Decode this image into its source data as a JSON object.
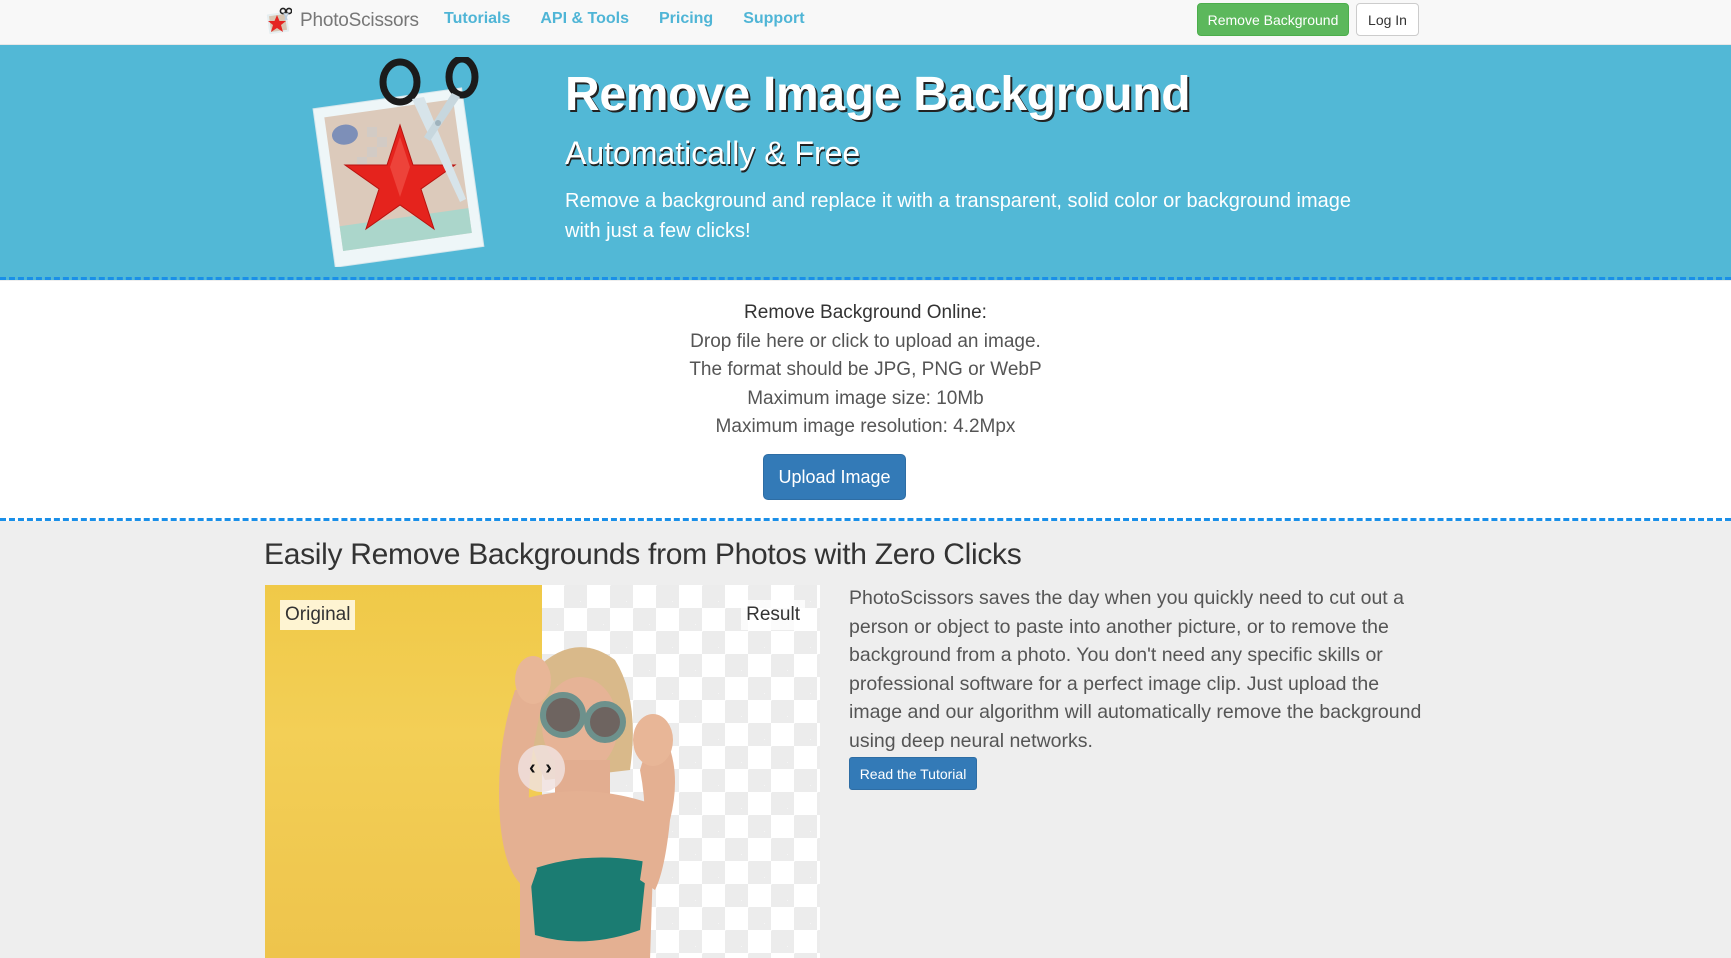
{
  "nav": {
    "brand": "PhotoScissors",
    "links": [
      "Tutorials",
      "API & Tools",
      "Pricing",
      "Support"
    ],
    "remove_background_label": "Remove Background",
    "login_label": "Log In"
  },
  "hero": {
    "title": "Remove Image Background",
    "subtitle": "Automatically & Free",
    "description": "Remove a background and replace it with a transparent, solid color or background image with just a few clicks!"
  },
  "upload": {
    "title": "Remove Background Online:",
    "lines": [
      "Drop file here or click to upload an image.",
      "The format should be JPG, PNG or WebP",
      "Maximum image size: 10Mb",
      "Maximum image resolution: 4.2Mpx"
    ],
    "button_label": "Upload Image"
  },
  "feature": {
    "heading": "Easily Remove Backgrounds from Photos with Zero Clicks",
    "label_original": "Original",
    "label_result": "Result",
    "slider_glyph": "‹ ›",
    "description": "PhotoScissors saves the day when you quickly need to cut out a person or object to paste into another picture, or to remove the background from a photo. You don't need any specific skills or professional software for a perfect image clip. Just upload the image and our algorithm will automatically remove the background using deep neural networks.",
    "tutorial_button_label": "Read the Tutorial"
  },
  "colors": {
    "hero_bg": "#52b8d6",
    "nav_link": "#4fb5d6",
    "success_button": "#5cb85c",
    "primary_button": "#337ab7",
    "dashed_border": "#1a8fe8",
    "section_bg": "#eeeeee"
  }
}
